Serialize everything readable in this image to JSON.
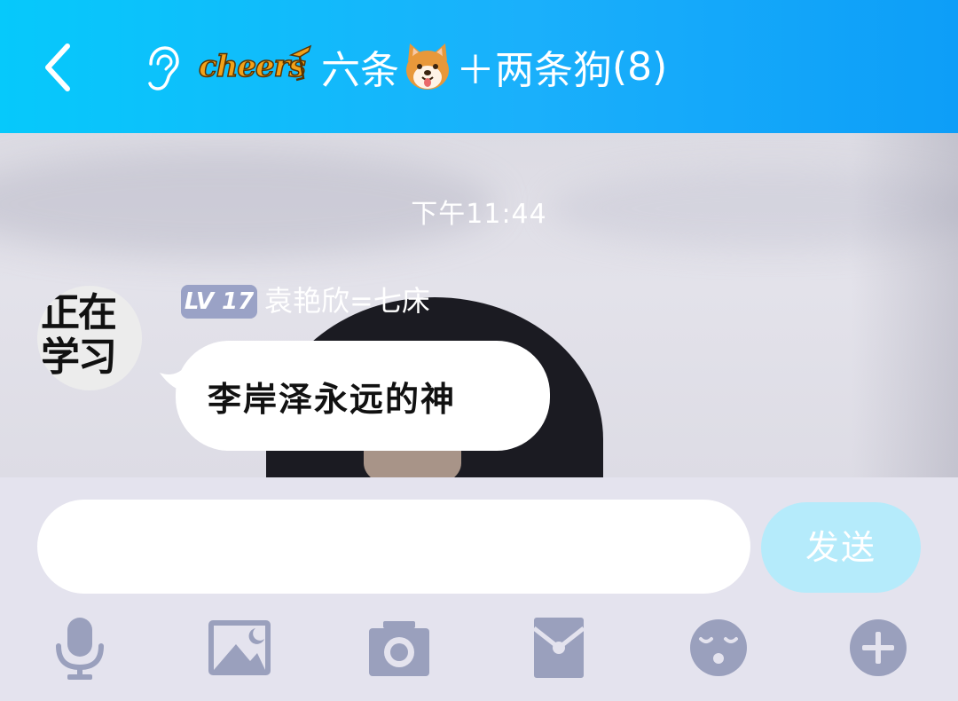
{
  "header": {
    "title_prefix": "六条",
    "title_middle": "＋两条狗",
    "member_count": "(8)",
    "brand_logo_text": "cheers"
  },
  "chat": {
    "timestamp": "下午11:44",
    "messages": [
      {
        "sender_level": "LV 17",
        "sender_name": "袁艳欣=七床",
        "avatar_text": "正在学习",
        "text": "李岸泽永远的神"
      }
    ]
  },
  "input": {
    "value": "",
    "placeholder": "",
    "send_label": "发送"
  },
  "toolbar": {
    "items": [
      "microphone-icon",
      "image-icon",
      "camera-icon",
      "red-packet-icon",
      "emoji-icon",
      "plus-icon"
    ]
  },
  "colors": {
    "header_start": "#06c9fb",
    "header_end": "#0d9ef8",
    "send_button": "#b5ebfb",
    "level_badge": "#9aa2c6",
    "toolbar_icon": "#9aa0bd"
  }
}
